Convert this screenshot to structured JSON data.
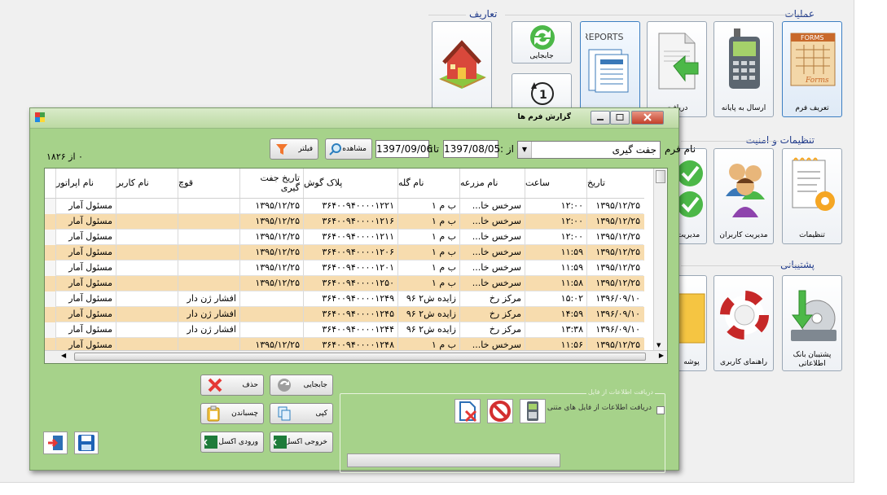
{
  "desktop": {
    "group_operations": "عملیات",
    "group_definitions": "تعاریف",
    "group_settings": "تنظیمات و امنیت",
    "group_support": "پشتیبانی",
    "tiles": {
      "define_form": "تعریف فرم",
      "send_terminal": "ارسال به پایانه",
      "receive": "دریافت",
      "transfer": "جابجایی",
      "settings": "تنظیمات",
      "user_management": "مدیریت کاربران",
      "management": "مدیریت",
      "bank_backup": "پشتیبان بانک اطلاعاتی",
      "user_guide": "راهنمای کاربری",
      "folder": "پوشه"
    }
  },
  "window": {
    "title": "گزارش فرم ها",
    "form_name_label": "نام فرم",
    "form_name_value": "جفت گیری",
    "from_label": "از :",
    "from_date": "1397/08/05",
    "to_label": "تا:",
    "to_date": "1397/09/06",
    "view_button": "مشاهده",
    "filter_button": "فیلتر",
    "record_count": "۰ از ۱۸۲۶",
    "buttons": {
      "delete": "حذف",
      "transfer": "جابجایی",
      "paste": "چسباندن",
      "copy": "کپی",
      "excel_import": "ورودی اکسل",
      "excel_export": "خروجی اکسل"
    },
    "panel_title": "دریافت اطلاعات از فایل",
    "panel_checkbox": "دریافت اطلاعات از فایل های متنی"
  },
  "table": {
    "columns": [
      "تاریخ",
      "ساعت",
      "نام مزرعه",
      "نام گله",
      "پلاک گوش",
      "تاریخ جفت گیری",
      "قوچ",
      "نام کاربر",
      "نام اپراتور"
    ],
    "rows": [
      [
        "۱۳۹۵/۱۲/۲۵",
        "۱۲:۰۰",
        "سرخس خا...",
        "ب م ۱",
        "۳۶۴۰۰۹۴۰۰۰۰۱۲۲۱",
        "۱۳۹۵/۱۲/۲۵",
        "",
        "",
        "مسئول آمار"
      ],
      [
        "۱۳۹۵/۱۲/۲۵",
        "۱۲:۰۰",
        "سرخس خا...",
        "ب م ۱",
        "۳۶۴۰۰۹۴۰۰۰۰۱۲۱۶",
        "۱۳۹۵/۱۲/۲۵",
        "",
        "",
        "مسئول آمار"
      ],
      [
        "۱۳۹۵/۱۲/۲۵",
        "۱۲:۰۰",
        "سرخس خا...",
        "ب م ۱",
        "۳۶۴۰۰۹۴۰۰۰۰۱۲۱۱",
        "۱۳۹۵/۱۲/۲۵",
        "",
        "",
        "مسئول آمار"
      ],
      [
        "۱۳۹۵/۱۲/۲۵",
        "۱۱:۵۹",
        "سرخس خا...",
        "ب م ۱",
        "۳۶۴۰۰۹۴۰۰۰۰۱۲۰۶",
        "۱۳۹۵/۱۲/۲۵",
        "",
        "",
        "مسئول آمار"
      ],
      [
        "۱۳۹۵/۱۲/۲۵",
        "۱۱:۵۹",
        "سرخس خا...",
        "ب م ۱",
        "۳۶۴۰۰۹۴۰۰۰۰۱۲۰۱",
        "۱۳۹۵/۱۲/۲۵",
        "",
        "",
        "مسئول آمار"
      ],
      [
        "۱۳۹۵/۱۲/۲۵",
        "۱۱:۵۸",
        "سرخس خا...",
        "ب م ۱",
        "۳۶۴۰۰۹۴۰۰۰۰۱۲۵۰",
        "۱۳۹۵/۱۲/۲۵",
        "",
        "",
        "مسئول آمار"
      ],
      [
        "۱۳۹۶/۰۹/۱۰",
        "۱۵:۰۲",
        "مرکز رخ",
        "زایده ش۲ ۹۶",
        "۳۶۴۰۰۹۴۰۰۰۰۱۲۴۹",
        "",
        "افشار ژن دار",
        "",
        "مسئول آمار"
      ],
      [
        "۱۳۹۶/۰۹/۱۰",
        "۱۴:۵۹",
        "مرکز رخ",
        "زایده ش۲ ۹۶",
        "۳۶۴۰۰۹۴۰۰۰۰۱۲۴۵",
        "",
        "افشار ژن دار",
        "",
        "مسئول آمار"
      ],
      [
        "۱۳۹۶/۰۹/۱۰",
        "۱۳:۳۸",
        "مرکز رخ",
        "زایده ش۲ ۹۶",
        "۳۶۴۰۰۹۴۰۰۰۰۱۲۴۴",
        "",
        "افشار ژن دار",
        "",
        "مسئول آمار"
      ],
      [
        "۱۳۹۵/۱۲/۲۵",
        "۱۱:۵۶",
        "سرخس خا...",
        "ب م ۱",
        "۳۶۴۰۰۹۴۰۰۰۰۱۲۴۸",
        "۱۳۹۵/۱۲/۲۵",
        "",
        "",
        "مسئول آمار"
      ]
    ]
  },
  "colors": {
    "window_body": "#a6d28a",
    "row_alt": "#f7dcae"
  }
}
